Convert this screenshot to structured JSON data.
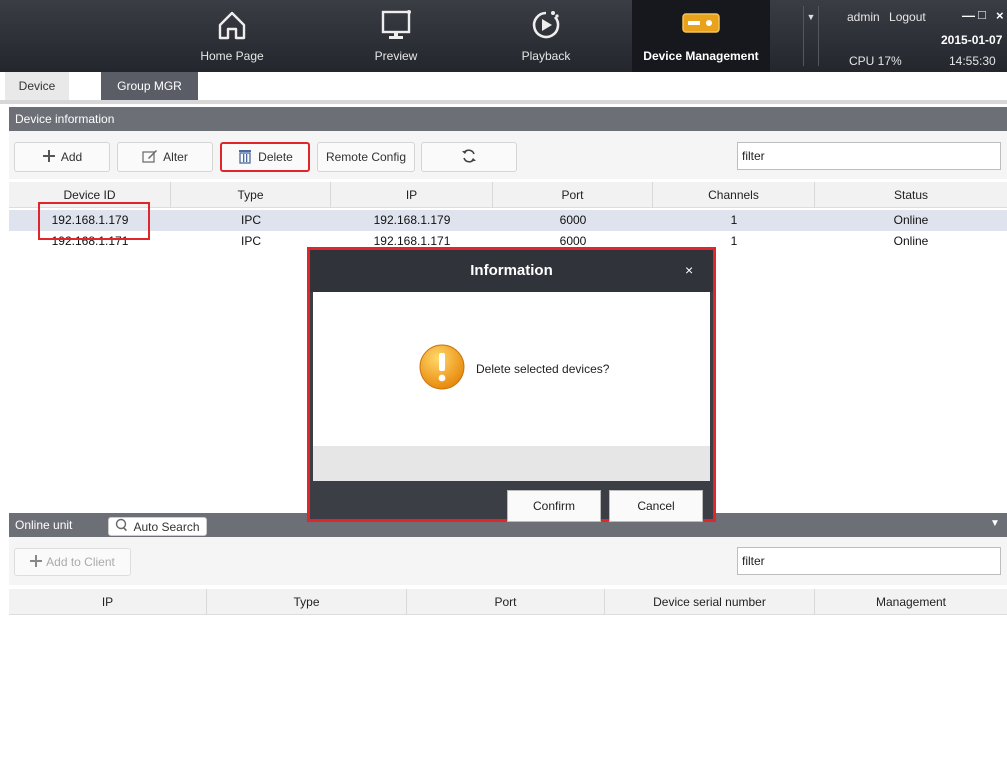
{
  "nav": {
    "home_label": "Home Page",
    "preview_label": "Preview",
    "playback_label": "Playback",
    "device_mgmt_label": "Device Management"
  },
  "user": {
    "username": "admin",
    "logout_label": "Logout",
    "date": "2015-01-07",
    "cpu": "CPU 17%",
    "time": "14:55:30"
  },
  "window": {
    "min": "—",
    "max": "□",
    "close": "×"
  },
  "tabs": {
    "device": "Device",
    "group": "Group MGR"
  },
  "device_info": {
    "title": "Device information",
    "add_label": "Add",
    "alter_label": "Alter",
    "delete_label": "Delete",
    "remote_label": "Remote Config",
    "filter_value": "filter",
    "columns": [
      "Device ID",
      "Type",
      "IP",
      "Port",
      "Channels",
      "Status"
    ],
    "rows": [
      [
        "192.168.1.179",
        "IPC",
        "192.168.1.179",
        "6000",
        "1",
        "Online"
      ],
      [
        "192.168.1.171",
        "IPC",
        "192.168.1.171",
        "6000",
        "1",
        "Online"
      ]
    ]
  },
  "online_unit": {
    "title": "Online unit",
    "auto_search_label": "Auto Search",
    "add_client_label": "Add to Client",
    "filter_value": "filter",
    "columns": [
      "IP",
      "Type",
      "Port",
      "Device serial number",
      "Management"
    ]
  },
  "dialog": {
    "title": "Information",
    "message": "Delete selected devices?",
    "confirm_label": "Confirm",
    "cancel_label": "Cancel",
    "close_glyph": "×"
  },
  "colors": {
    "highlight": "#e0262b",
    "header_bg": "#6d6f77",
    "topbar_bg": "#2b2d34",
    "selected_row": "#dfe3ee"
  }
}
